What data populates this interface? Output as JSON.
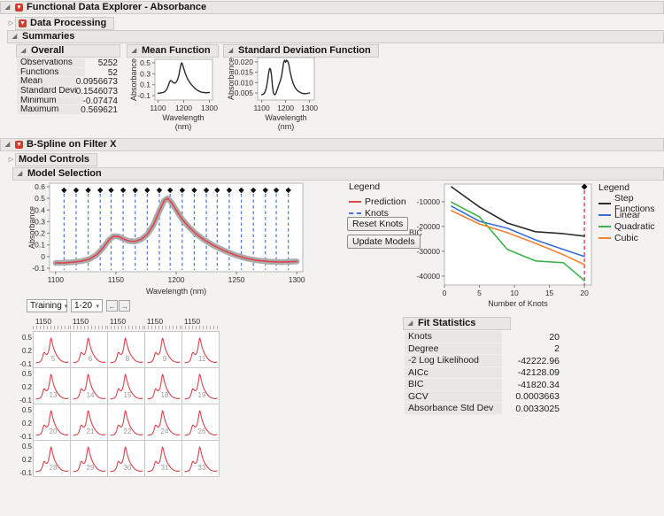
{
  "window": {
    "title": "Functional Data Explorer - Absorbance"
  },
  "sections": {
    "data_processing": "Data Processing",
    "summaries": "Summaries",
    "overall": "Overall",
    "mean_function": "Mean Function",
    "sd_function": "Standard Deviation Function",
    "bspline": "B-Spline on Filter X",
    "model_controls": "Model Controls",
    "model_selection": "Model Selection",
    "fit_statistics": "Fit Statistics"
  },
  "overall_table": {
    "rows": [
      [
        "Observations",
        "5252"
      ],
      [
        "Functions",
        "52"
      ],
      [
        "Mean",
        "0.0956673"
      ],
      [
        "Standard Deviation",
        "0.1546073"
      ],
      [
        "Minimum",
        "-0.07474"
      ],
      [
        "Maximum",
        "0.569621"
      ]
    ]
  },
  "fit_statistics_table": {
    "rows": [
      [
        "Knots",
        "20"
      ],
      [
        "Degree",
        "2"
      ],
      [
        "-2 Log Likelihood",
        "-42222.96"
      ],
      [
        "AICc",
        "-42128.09"
      ],
      [
        "BIC",
        "-41820.34"
      ],
      [
        "GCV",
        "0.0003663"
      ],
      [
        "Absorbance Std Dev",
        "0.0033025"
      ]
    ]
  },
  "controls": {
    "training_select": "Training",
    "range_select": "1-20",
    "prev_icon": "←",
    "next_icon": "→",
    "reset_knots": "Reset Knots",
    "update_models": "Update Models",
    "dropdown_caret": "▾"
  },
  "legend_left": {
    "title": "Legend",
    "items": [
      {
        "label": "Prediction",
        "color": "#e0454e",
        "dash": false
      },
      {
        "label": "Knots",
        "color": "#4a74e0",
        "dash": true
      }
    ]
  },
  "chart_data": [
    {
      "id": "mean_function",
      "type": "line",
      "xlabel": "Wavelength",
      "xlabel2": "(nm)",
      "ylabel": "Absorbance",
      "xlim": [
        1088,
        1312
      ],
      "ylim": [
        -0.18,
        0.565
      ],
      "xticks": [
        1100,
        1200,
        1300
      ],
      "yticks": [
        0.5,
        0.3,
        0.1,
        -0.1
      ],
      "ytick_labels": [
        "0.5",
        "0.3",
        "0.1",
        "-0.1"
      ],
      "line_color": "#2b2b2b",
      "points": [
        [
          1100,
          -0.055
        ],
        [
          1107,
          -0.053
        ],
        [
          1114,
          -0.048
        ],
        [
          1121,
          -0.04
        ],
        [
          1128,
          -0.022
        ],
        [
          1134,
          0.015
        ],
        [
          1139,
          0.07
        ],
        [
          1144,
          0.14
        ],
        [
          1148,
          0.175
        ],
        [
          1152,
          0.173
        ],
        [
          1156,
          0.152
        ],
        [
          1161,
          0.133
        ],
        [
          1166,
          0.13
        ],
        [
          1171,
          0.148
        ],
        [
          1176,
          0.19
        ],
        [
          1181,
          0.27
        ],
        [
          1186,
          0.39
        ],
        [
          1190,
          0.48
        ],
        [
          1193,
          0.5
        ],
        [
          1196,
          0.465
        ],
        [
          1200,
          0.4
        ],
        [
          1205,
          0.32
        ],
        [
          1210,
          0.26
        ],
        [
          1216,
          0.2
        ],
        [
          1223,
          0.145
        ],
        [
          1231,
          0.095
        ],
        [
          1240,
          0.05
        ],
        [
          1249,
          0.012
        ],
        [
          1258,
          -0.015
        ],
        [
          1267,
          -0.033
        ],
        [
          1277,
          -0.043
        ],
        [
          1288,
          -0.047
        ],
        [
          1300,
          -0.042
        ]
      ]
    },
    {
      "id": "sd_function",
      "type": "line",
      "xlabel": "Wavelength",
      "xlabel2": "(nm)",
      "ylabel": "Absorbance",
      "xlim": [
        1083,
        1320
      ],
      "ylim": [
        0.0016,
        0.0221
      ],
      "xticks": [
        1100,
        1200,
        1300
      ],
      "yticks": [
        0.02,
        0.015,
        0.01,
        0.005
      ],
      "ytick_labels": [
        "0.020",
        "0.015",
        "0.010",
        "0.005"
      ],
      "line_color": "#2b2b2b",
      "points": [
        [
          1100,
          0.0042
        ],
        [
          1107,
          0.0044
        ],
        [
          1113,
          0.0052
        ],
        [
          1119,
          0.0072
        ],
        [
          1124,
          0.0105
        ],
        [
          1129,
          0.0145
        ],
        [
          1133,
          0.0168
        ],
        [
          1137,
          0.0165
        ],
        [
          1141,
          0.0135
        ],
        [
          1145,
          0.0085
        ],
        [
          1149,
          0.005
        ],
        [
          1154,
          0.0041
        ],
        [
          1159,
          0.0046
        ],
        [
          1165,
          0.0065
        ],
        [
          1171,
          0.0088
        ],
        [
          1177,
          0.0106
        ],
        [
          1183,
          0.013
        ],
        [
          1188,
          0.0168
        ],
        [
          1192,
          0.0198
        ],
        [
          1196,
          0.0208
        ],
        [
          1200,
          0.0198
        ],
        [
          1204,
          0.0208
        ],
        [
          1209,
          0.0203
        ],
        [
          1214,
          0.0185
        ],
        [
          1219,
          0.0152
        ],
        [
          1225,
          0.0122
        ],
        [
          1232,
          0.0095
        ],
        [
          1240,
          0.0075
        ],
        [
          1249,
          0.0062
        ],
        [
          1259,
          0.0054
        ],
        [
          1270,
          0.0048
        ],
        [
          1282,
          0.0046
        ],
        [
          1300,
          0.005
        ]
      ]
    },
    {
      "id": "model_selection",
      "type": "line",
      "xlabel": "Wavelength (nm)",
      "ylabel": "Absorbance",
      "xlim": [
        1095,
        1305
      ],
      "ylim": [
        -0.13,
        0.63
      ],
      "xticks": [
        1100,
        1150,
        1200,
        1250,
        1300
      ],
      "yticks": [
        0.6,
        0.5,
        0.4,
        0.3,
        0.2,
        0.1,
        0,
        -0.1
      ],
      "ytick_labels": [
        "0.6",
        "0.5",
        "0.4",
        "0.3",
        "0.2",
        "0.1",
        "0",
        "-0.1"
      ],
      "knots": [
        1107,
        1117,
        1127,
        1137,
        1146,
        1156,
        1166,
        1176,
        1186,
        1195,
        1205,
        1215,
        1225,
        1234,
        1244,
        1254,
        1264,
        1274,
        1283,
        1293
      ],
      "knot_marker_y": 0.57,
      "band_color": "#ababab",
      "prediction_color": "#e0454e",
      "knot_color": "#4a74e0",
      "marker_color": "#111111"
    },
    {
      "id": "bic_by_knots",
      "type": "line",
      "xlabel": "Number of Knots",
      "ylabel": "BIC",
      "xlim": [
        0,
        21
      ],
      "ylim": [
        -43600,
        -2900
      ],
      "xticks": [
        0,
        5,
        10,
        15,
        20
      ],
      "yticks": [
        -10000,
        -20000,
        -30000,
        -40000
      ],
      "ytick_labels": [
        "-10000",
        "-20000",
        "-30000",
        "-40000"
      ],
      "x": [
        1,
        5,
        9,
        13,
        17,
        20
      ],
      "series": [
        {
          "name": "Step Functions",
          "color": "#2b2b2b",
          "values": [
            -4000,
            -12100,
            -18600,
            -22100,
            -22900,
            -23900
          ]
        },
        {
          "name": "Linear",
          "color": "#3a6fd8",
          "values": [
            -11800,
            -17900,
            -20700,
            -25400,
            -29300,
            -32100
          ]
        },
        {
          "name": "Quadratic",
          "color": "#3cb44b",
          "values": [
            -10200,
            -16100,
            -29300,
            -33900,
            -34600,
            -41820
          ]
        },
        {
          "name": "Cubic",
          "color": "#f58231",
          "values": [
            -13600,
            -19000,
            -22500,
            -26800,
            -31400,
            -35400
          ]
        }
      ],
      "selected_knots_refline": {
        "x": 20,
        "color": "#f2575f"
      },
      "selected_marker": {
        "x": 20,
        "symbol": "diamond",
        "color": "#111111"
      },
      "legend_title": "Legend"
    },
    {
      "id": "function_grid",
      "type": "small-multiples",
      "col_axis_label": "1150",
      "row_tick_labels": [
        "0.5",
        "0.2",
        "-0.1"
      ],
      "row_tick_values": [
        0.5,
        0.2,
        -0.1
      ],
      "cell_ids": [
        [
          5,
          6,
          8,
          9,
          11
        ],
        [
          13,
          14,
          15,
          18,
          19
        ],
        [
          20,
          21,
          22,
          24,
          26
        ],
        [
          28,
          29,
          30,
          31,
          33
        ]
      ],
      "line_color": "#d6454e"
    }
  ]
}
